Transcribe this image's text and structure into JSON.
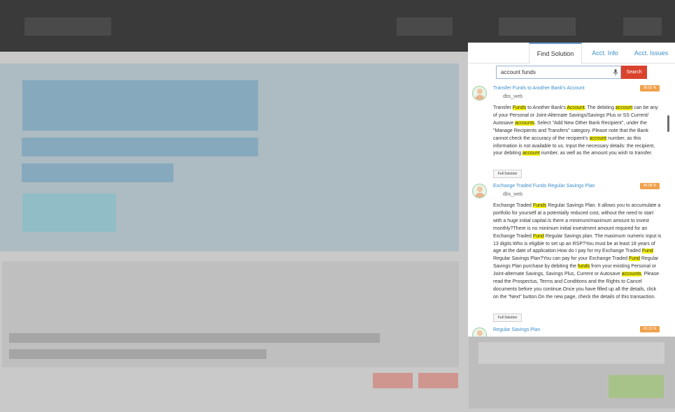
{
  "panel": {
    "tabs": [
      "Find Solution",
      "Acct. Info",
      "Acct. Issues"
    ],
    "active_tab": "Find Solution",
    "search": {
      "value": "account funds",
      "button_label": "Search"
    },
    "results": [
      {
        "title": "Transfer Funds to Another Bank's Account",
        "score": "96.02 %",
        "source": "dbs_web",
        "body": [
          [
            "Transfer ",
            ""
          ],
          [
            "Funds",
            "hl"
          ],
          [
            " to Another Bank's ",
            ""
          ],
          [
            "Account",
            "hl"
          ],
          [
            ". The debiting ",
            ""
          ],
          [
            "account",
            "hl"
          ],
          [
            " can be any of your Personal or Joint-Alternate Savings/Savings Plus or SS Current/ Autosave ",
            ""
          ],
          [
            "accounts",
            "hl"
          ],
          [
            ". Select \"Add New Other Bank Recipient\", under the \"Manage Recipients and Transfers\" category. Please note that the Bank cannot check the accuracy of the recipient's ",
            ""
          ],
          [
            "account",
            "hl"
          ],
          [
            " number, as this information is not available to us. Input the necessary details: the recipient, your debiting ",
            ""
          ],
          [
            "account",
            "hl"
          ],
          [
            " number, as well as the amount you wish to transfer.",
            ""
          ]
        ],
        "button_label": "Full Solution"
      },
      {
        "title": "Exchange Traded Funds Regular Savings Plan",
        "score": "84.08 %",
        "source": "dbs_web",
        "body": [
          [
            "Exchange Traded ",
            ""
          ],
          [
            "Funds",
            "hl"
          ],
          [
            " Regular Savings Plan. It allows you to accumulate a portfolio for yourself at a potentially reduced cost, without the need to start with a huge initial capital.Is there a minimum/maximum amount to invest monthly?There is no minimum initial investment amount required for an Exchange Traded ",
            ""
          ],
          [
            "Fund",
            "hl"
          ],
          [
            " Regular Savings plan. The maximum numeric input is 13 digits.Who is eligible to set up an RSP?You must be at least 18 years of age at the date of application.How do I pay for my Exchange Traded ",
            ""
          ],
          [
            "Fund",
            "hl"
          ],
          [
            " Regular Savings Plan?You can pay for your Exchange Traded ",
            ""
          ],
          [
            "Fund",
            "hl"
          ],
          [
            " Regular Savings Plan purchase by debiting the ",
            ""
          ],
          [
            "funds",
            "hl"
          ],
          [
            " from your existing Personal or Joint-alternate Savings, Savings Plus, Current or Autosave ",
            ""
          ],
          [
            "accounts",
            "hl"
          ],
          [
            ". Please read the Prospectus, Terms and Conditions and the Rights to Cancel documents before you continue.Once you have filled up all the details, click on the \"Next\" button.On the new page, check the details of this transaction.",
            ""
          ]
        ],
        "button_label": "Full Solution"
      },
      {
        "title": "Regular Savings Plan",
        "score": "83.13 %"
      }
    ]
  },
  "colors": {
    "search_button": "#d9422d",
    "score_badge": "#f0a14c",
    "highlight": "#f5f10d",
    "link": "#3b8ec9"
  },
  "icons": [
    "mic-icon",
    "user-avatar-icon"
  ]
}
